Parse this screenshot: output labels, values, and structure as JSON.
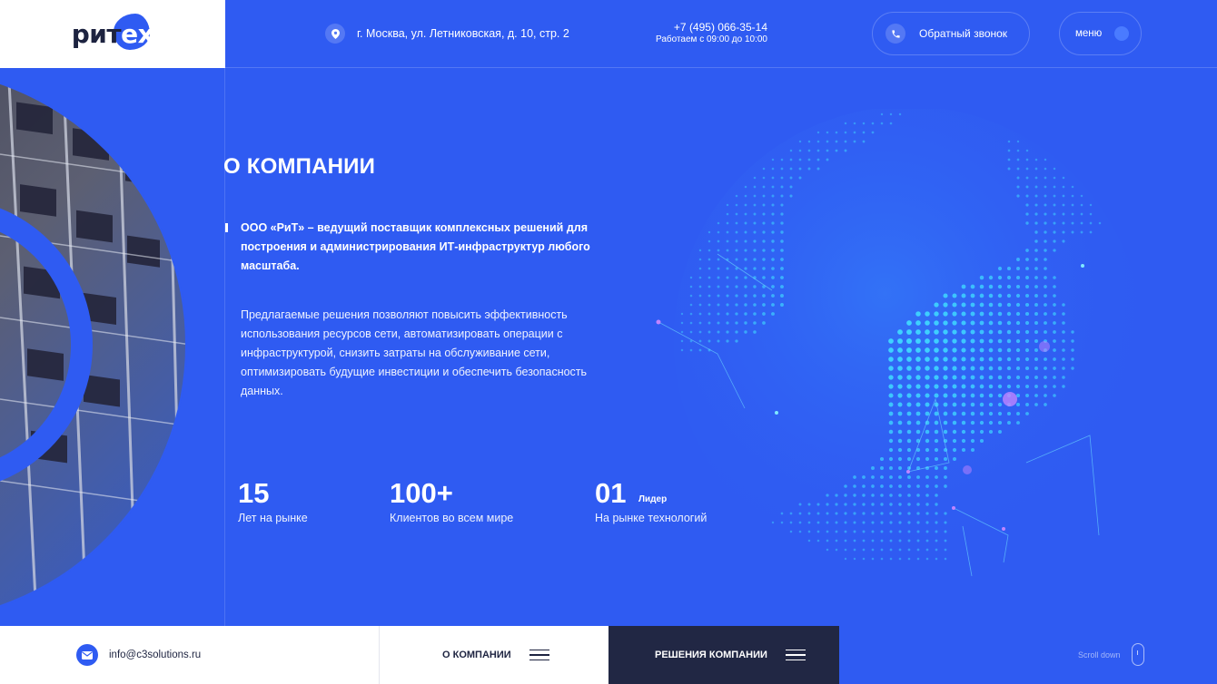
{
  "brand": {
    "logo_part1": "рит",
    "logo_part2": "ex"
  },
  "header": {
    "address": "г. Москва, ул. Летниковская, д. 10, стр. 2",
    "phone": "+7 (495) 066-35-14",
    "hours": "Работаем с 09:00 до 10:00",
    "callback_label": "Обратный звонок",
    "menu_label": "меню"
  },
  "main": {
    "title": "О КОМПАНИИ",
    "lead": "ООО «РиТ» – ведущий поставщик комплексных решений для построения и администрирования ИТ-инфраструктур любого масштаба.",
    "description": "Предлагаемые решения позволяют повысить эффективность использования ресурсов сети, автоматизировать операции с инфраструктурой, снизить затраты на обслуживание сети, оптимизировать будущие инвестиции и обеспечить безопасность данных.",
    "stats": [
      {
        "value": "15",
        "label": "Лет на рынке"
      },
      {
        "value": "100+",
        "label": "Клиентов во всем мире"
      },
      {
        "value": "01",
        "tag": "Лидер",
        "label": "На рынке технологий"
      }
    ]
  },
  "footer": {
    "email": "info@c3solutions.ru",
    "about_label": "О КОМПАНИИ",
    "solutions_label": "РЕШЕНИЯ КОМПАНИИ",
    "scroll_label": "Scroll down"
  },
  "colors": {
    "background": "#2f5bf2",
    "dark": "#212744",
    "accent": "#4a7bff",
    "globe": "#3fd6ff"
  },
  "icons": [
    "location-pin-icon",
    "phone-icon",
    "menu-dot-icon",
    "mail-icon",
    "burger-icon",
    "mouse-icon"
  ]
}
